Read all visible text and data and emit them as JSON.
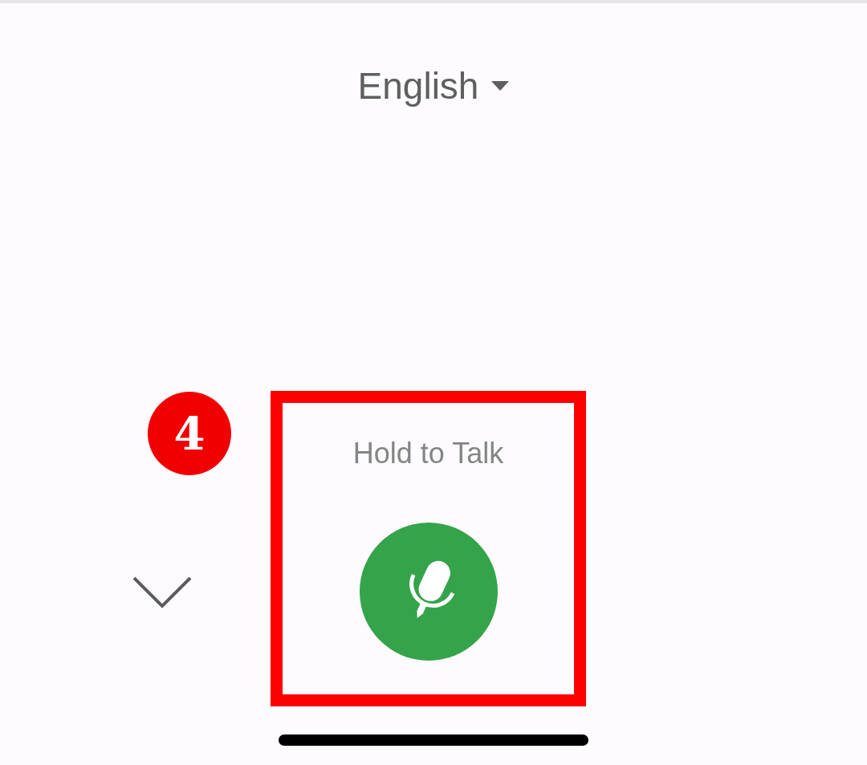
{
  "language_selector": {
    "label": "English"
  },
  "annotation": {
    "number": "4"
  },
  "talk_panel": {
    "label": "Hold to Talk"
  }
}
